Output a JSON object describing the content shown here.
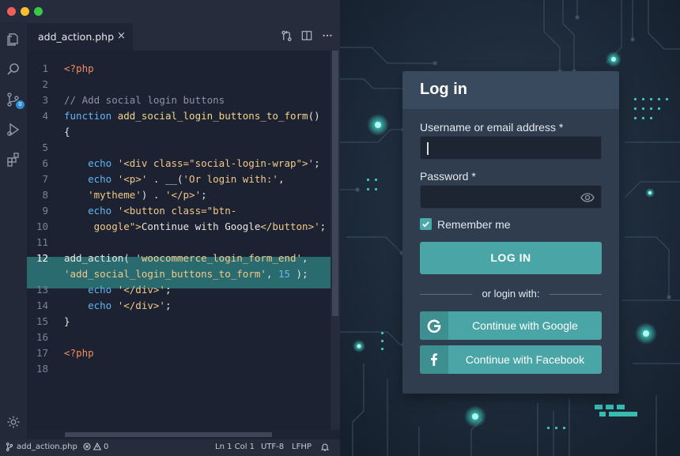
{
  "editor": {
    "tab": {
      "file_name": "add_action.php",
      "close_glyph": "×"
    },
    "toolbar_icons": [
      "source-control-icon",
      "split-editor-icon",
      "more-icon"
    ],
    "activity_icons": [
      "explorer-icon",
      "search-icon",
      "source-control-icon",
      "run-debug-icon",
      "extensions-icon",
      "settings-gear-icon"
    ],
    "source_control_badge": "0",
    "active_line": "12",
    "lines": [
      {
        "n": "1",
        "parts": [
          {
            "t": "<?php",
            "c": "php"
          }
        ]
      },
      {
        "n": "2",
        "parts": []
      },
      {
        "n": "3",
        "parts": [
          {
            "t": "// Add social login buttons",
            "c": "com"
          }
        ]
      },
      {
        "n": "4",
        "parts": [
          {
            "t": "function ",
            "c": "fn"
          },
          {
            "t": "add_social_login_buttons_to_form",
            "c": "name"
          },
          {
            "t": "()",
            "c": ""
          }
        ]
      },
      {
        "n": "",
        "parts": [
          {
            "t": "{",
            "c": ""
          }
        ]
      },
      {
        "n": "5",
        "parts": []
      },
      {
        "n": "6",
        "parts": [
          {
            "t": "    echo ",
            "c": "fn"
          },
          {
            "t": "'<div class=\"social-login-wrap\">'",
            "c": "str"
          },
          {
            "t": ";",
            "c": ""
          }
        ]
      },
      {
        "n": "7",
        "parts": [
          {
            "t": "    echo ",
            "c": "fn"
          },
          {
            "t": "'<p>'",
            "c": "str"
          },
          {
            "t": " . __(",
            "c": ""
          },
          {
            "t": "'Or login with:'",
            "c": "str"
          },
          {
            "t": ",",
            "c": ""
          }
        ]
      },
      {
        "n": "8",
        "parts": [
          {
            "t": "    'mytheme'",
            "c": "str"
          },
          {
            "t": ") . ",
            "c": ""
          },
          {
            "t": "'</p>'",
            "c": "str"
          },
          {
            "t": ";",
            "c": ""
          }
        ]
      },
      {
        "n": "9",
        "parts": [
          {
            "t": "    echo ",
            "c": "fn"
          },
          {
            "t": "'<button class=\"btn-",
            "c": "str"
          }
        ]
      },
      {
        "n": "10",
        "parts": [
          {
            "t": "     google\">",
            "c": "str"
          },
          {
            "t": "Continue with Google",
            "c": ""
          },
          {
            "t": "</button>'",
            "c": "str"
          },
          {
            "t": ";",
            "c": ""
          }
        ]
      },
      {
        "n": "11",
        "parts": []
      },
      {
        "n": "12",
        "parts": [
          {
            "t": "add_action( ",
            "c": ""
          },
          {
            "t": "'woocommerce_login_form_end'",
            "c": "str"
          },
          {
            "t": ",",
            "c": ""
          }
        ]
      },
      {
        "n": "",
        "parts": [
          {
            "t": "'add_social_login_buttons_to_form'",
            "c": "str"
          },
          {
            "t": ", ",
            "c": ""
          },
          {
            "t": "15",
            "c": "num"
          },
          {
            "t": " );",
            "c": ""
          }
        ]
      },
      {
        "n": "13",
        "parts": [
          {
            "t": "    echo ",
            "c": "fn"
          },
          {
            "t": "'</div>'",
            "c": "str"
          },
          {
            "t": ";",
            "c": ""
          }
        ]
      },
      {
        "n": "14",
        "parts": [
          {
            "t": "    echo ",
            "c": "fn"
          },
          {
            "t": "'</div>'",
            "c": "str"
          },
          {
            "t": ";",
            "c": ""
          }
        ]
      },
      {
        "n": "15",
        "parts": [
          {
            "t": "}",
            "c": ""
          }
        ]
      },
      {
        "n": "16",
        "parts": []
      },
      {
        "n": "17",
        "parts": [
          {
            "t": "<?php",
            "c": "php"
          }
        ]
      },
      {
        "n": "18",
        "parts": []
      }
    ],
    "status": {
      "file_name": "add_action.php",
      "errors": "0",
      "warnings": "0",
      "cursor": "Ln 1 Col 1",
      "encoding": "UTF-8",
      "line_endings": "LFHP"
    }
  },
  "login": {
    "title": "Log in",
    "username_label": "Username or email address *",
    "password_label": "Password *",
    "remember_label": "Remember me",
    "remember_checked": true,
    "login_button": "LOG IN",
    "divider_text": "or login with:",
    "google_button": "Continue with Google",
    "facebook_button": "Continue with Facebook"
  },
  "colors": {
    "editor_bg": "#1d2232",
    "highlight_line": "#2a6b70",
    "accent_teal": "#4aa6a6",
    "card_bg": "#2f3d4f",
    "circuit_glow": "#3fd6c8"
  }
}
